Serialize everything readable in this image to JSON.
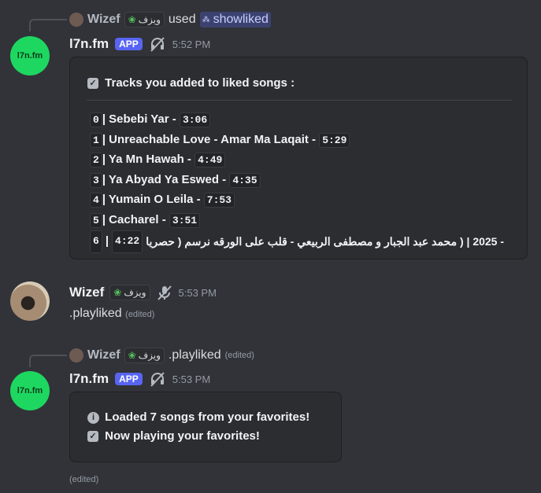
{
  "msg1": {
    "reply": {
      "user": "Wizef",
      "tag": "ويزف",
      "used": "used",
      "command": "showliked"
    },
    "bot_name": "l7n.fm",
    "avatar_text": "l7n.fm",
    "app_badge": "APP",
    "time": "5:52 PM",
    "embed": {
      "title": "Tracks you added to liked songs :",
      "tracks": [
        {
          "index": "0",
          "prefix": "| Sebebi Yar - ",
          "duration": "3:06"
        },
        {
          "index": "1",
          "prefix": "| Unreachable Love - Amar Ma Laqait - ",
          "duration": "5:29"
        },
        {
          "index": "2",
          "prefix": "| Ya Mn Hawah - ",
          "duration": "4:49"
        },
        {
          "index": "3",
          "prefix": "| Ya Abyad Ya Eswed - ",
          "duration": "4:35"
        },
        {
          "index": "4",
          "prefix": "| Yumain O Leila - ",
          "duration": "7:53"
        },
        {
          "index": "5",
          "prefix": "| Cacharel - ",
          "duration": "3:51"
        }
      ],
      "track6": {
        "index": "6",
        "duration": "4:22",
        "rest": "- 2025 | ( محمد عبد الجبار و مصطفى الربيعي - قلب على الورقه نرسم ( حصريا"
      }
    }
  },
  "msg2": {
    "user": "Wizef",
    "tag": "ويزف",
    "time": "5:53 PM",
    "text": ".playliked",
    "edited": "(edited)"
  },
  "msg3": {
    "reply": {
      "user": "Wizef",
      "tag": "ويزف",
      "text": ".playliked",
      "edited": "(edited)"
    },
    "bot_name": "l7n.fm",
    "avatar_text": "l7n.fm",
    "app_badge": "APP",
    "time": "5:53 PM",
    "embed": {
      "line1": "Loaded 7 songs from your favorites!",
      "line2": "Now playing your favorites!"
    },
    "edited": "(edited)"
  }
}
